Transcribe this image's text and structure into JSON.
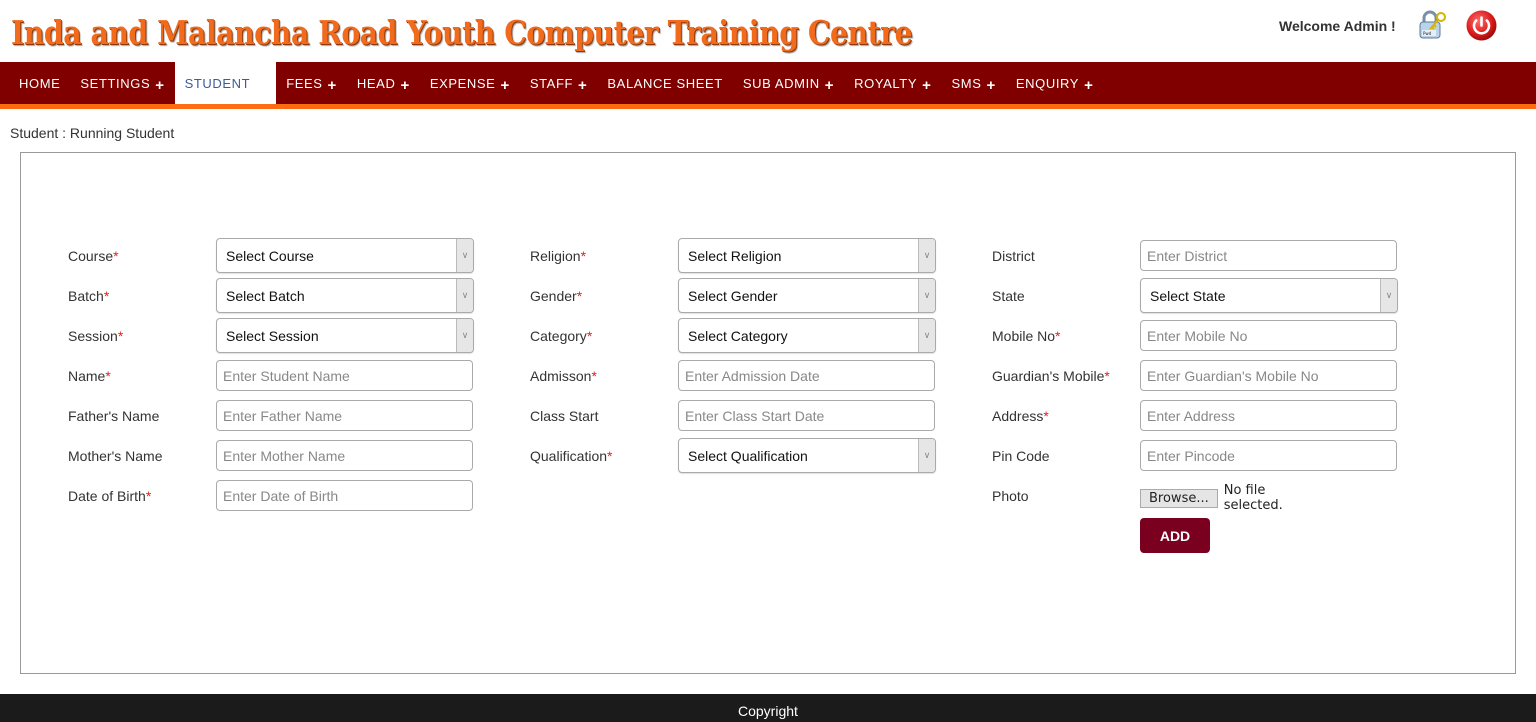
{
  "header": {
    "site_title": "Inda and Malancha Road Youth Computer Training Centre",
    "welcome_text": "Welcome Admin !",
    "icons": {
      "change_password": "lock-key-icon",
      "logout": "power-icon"
    },
    "brand_colors": {
      "title": "#f26b1d",
      "nav_background": "#800000",
      "nav_underline": "#ff6b10",
      "add_button": "#7a0020",
      "required_marker": "#e02020"
    }
  },
  "nav": {
    "items": [
      {
        "label": "HOME",
        "has_submenu": false,
        "active": false
      },
      {
        "label": "SETTINGS",
        "has_submenu": true,
        "active": false
      },
      {
        "label": "STUDENT",
        "has_submenu": false,
        "active": true
      },
      {
        "label": "FEES",
        "has_submenu": true,
        "active": false
      },
      {
        "label": "HEAD",
        "has_submenu": true,
        "active": false
      },
      {
        "label": "EXPENSE",
        "has_submenu": true,
        "active": false
      },
      {
        "label": "STAFF",
        "has_submenu": true,
        "active": false
      },
      {
        "label": "BALANCE SHEET",
        "has_submenu": false,
        "active": false
      },
      {
        "label": "SUB ADMIN",
        "has_submenu": true,
        "active": false
      },
      {
        "label": "ROYALTY",
        "has_submenu": true,
        "active": false
      },
      {
        "label": "SMS",
        "has_submenu": true,
        "active": false
      },
      {
        "label": "ENQUIRY",
        "has_submenu": true,
        "active": false
      }
    ],
    "submenu_symbol": "+"
  },
  "breadcrumb": "Student : Running Student",
  "form": {
    "required_marker": "*",
    "column1": [
      {
        "label": "Course",
        "required": true,
        "type": "select",
        "value": "Select Course"
      },
      {
        "label": "Batch",
        "required": true,
        "type": "select",
        "value": "Select Batch"
      },
      {
        "label": "Session",
        "required": true,
        "type": "select",
        "value": "Select Session"
      },
      {
        "label": "Name",
        "required": true,
        "type": "input",
        "value": "",
        "placeholder": "Enter Student Name"
      },
      {
        "label": "Father's Name",
        "required": false,
        "type": "input",
        "value": "",
        "placeholder": "Enter Father Name"
      },
      {
        "label": "Mother's Name",
        "required": false,
        "type": "input",
        "value": "",
        "placeholder": "Enter Mother Name"
      },
      {
        "label": "Date of Birth",
        "required": true,
        "type": "input",
        "value": "",
        "placeholder": "Enter Date of Birth"
      }
    ],
    "column2": [
      {
        "label": "Religion",
        "required": true,
        "type": "select",
        "value": "Select Religion"
      },
      {
        "label": "Gender",
        "required": true,
        "type": "select",
        "value": "Select Gender"
      },
      {
        "label": "Category",
        "required": true,
        "type": "select",
        "value": "Select Category"
      },
      {
        "label": "Admisson",
        "required": true,
        "type": "input",
        "value": "",
        "placeholder": "Enter Admission Date"
      },
      {
        "label": "Class Start",
        "required": false,
        "type": "input",
        "value": "",
        "placeholder": "Enter Class Start Date"
      },
      {
        "label": "Qualification",
        "required": true,
        "type": "select",
        "value": "Select Qualification"
      }
    ],
    "column3": [
      {
        "label": "District",
        "required": false,
        "type": "input",
        "value": "",
        "placeholder": "Enter District"
      },
      {
        "label": "State",
        "required": false,
        "type": "select",
        "value": "Select State"
      },
      {
        "label": "Mobile No",
        "required": true,
        "type": "input",
        "value": "",
        "placeholder": "Enter Mobile No"
      },
      {
        "label": "Guardian's Mobile",
        "required": true,
        "type": "input",
        "value": "",
        "placeholder": "Enter Guardian's Mobile No"
      },
      {
        "label": "Address",
        "required": true,
        "type": "input",
        "value": "",
        "placeholder": "Enter Address"
      },
      {
        "label": "Pin Code",
        "required": false,
        "type": "input",
        "value": "",
        "placeholder": "Enter Pincode"
      }
    ],
    "photo": {
      "label": "Photo",
      "browse_label": "Browse...",
      "file_status": "No file selected."
    },
    "add_button_label": "ADD"
  },
  "footer": {
    "text": "Copyright"
  }
}
